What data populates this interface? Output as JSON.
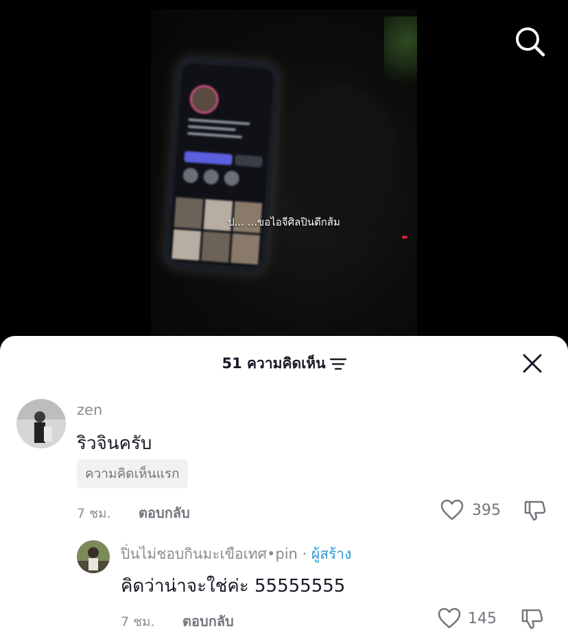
{
  "video": {
    "caption": "ป... ...ขอไอจีศิลปินตึกส้ม"
  },
  "comments_sheet": {
    "title": "51 ความคิดเห็น",
    "comments": [
      {
        "username": "zen",
        "text": "ริวจินครับ",
        "tag": "ความคิดเห็นแรก",
        "time": "7 ชม.",
        "reply_label": "ตอบกลับ",
        "likes": "395"
      },
      {
        "username": "ปิ่นไม่ชอบกินมะเขือเทศ•pin",
        "separator": "·",
        "creator_label": "ผู้สร้าง",
        "text": "คิดว่าน่าจะใช่ค่ะ 55555555",
        "time": "7 ชม.",
        "reply_label": "ตอบกลับ",
        "likes": "145"
      }
    ]
  },
  "icons": {
    "search": "search-icon",
    "sort": "sort-icon",
    "close": "close-icon",
    "like": "heart-icon",
    "dislike": "thumbs-down-icon"
  },
  "colors": {
    "creator_accent": "#2b9bd6",
    "text_primary": "#161823",
    "text_secondary": "#8a8b91"
  }
}
